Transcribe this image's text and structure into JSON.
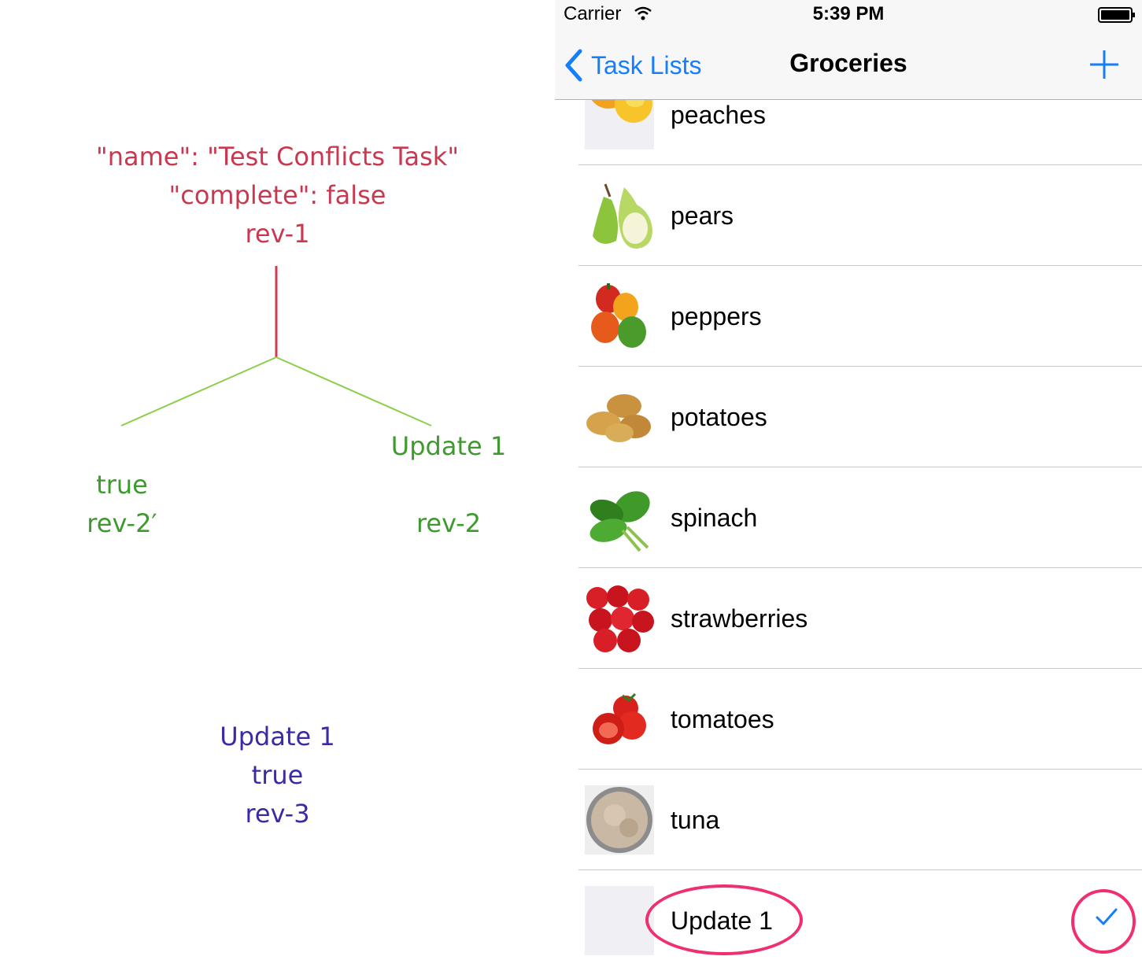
{
  "diagram": {
    "root": {
      "name_line": "\"name\": \"Test Conflicts Task\"",
      "complete_line": "\"complete\": false",
      "rev": "rev-1"
    },
    "left_branch": {
      "value": "true",
      "rev": "rev-2′"
    },
    "right_branch": {
      "value": "Update 1",
      "rev": "rev-2"
    },
    "merged": {
      "name": "Update 1",
      "value": "true",
      "rev": "rev-3"
    },
    "colors": {
      "root": "#c9384f",
      "branch": "#3e9a2e",
      "merged": "#3a2ba5",
      "branch_line": "#8ed04c"
    }
  },
  "status_bar": {
    "carrier": "Carrier",
    "time": "5:39 PM"
  },
  "nav_bar": {
    "back_label": "Task Lists",
    "title": "Groceries",
    "accent": "#157efb"
  },
  "tasks": [
    {
      "name": "peaches",
      "image": "peaches-photo"
    },
    {
      "name": "pears",
      "image": "pears-photo"
    },
    {
      "name": "peppers",
      "image": "peppers-photo"
    },
    {
      "name": "potatoes",
      "image": "potatoes-photo"
    },
    {
      "name": "spinach",
      "image": "spinach-photo"
    },
    {
      "name": "strawberries",
      "image": "strawberries-photo"
    },
    {
      "name": "tomatoes",
      "image": "tomatoes-photo"
    },
    {
      "name": "tuna",
      "image": "tuna-photo"
    },
    {
      "name": "Update 1",
      "image": "empty-placeholder",
      "checked": true
    }
  ],
  "highlight_color": "#ef2f70"
}
